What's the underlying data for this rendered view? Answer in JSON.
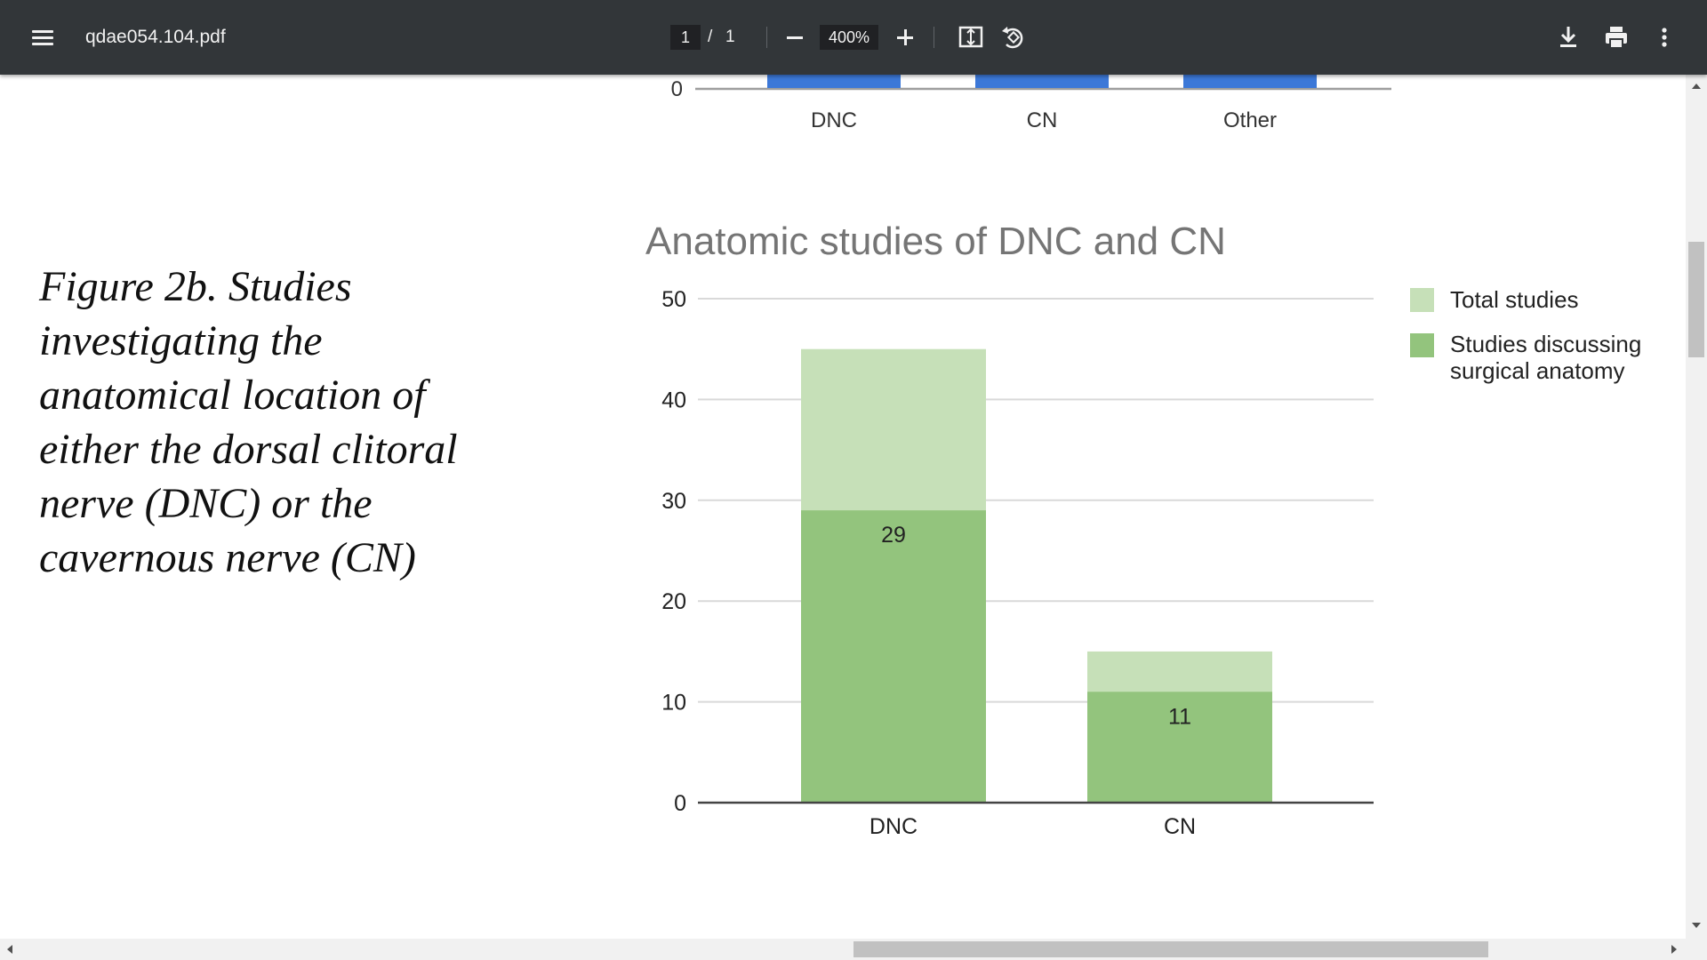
{
  "toolbar": {
    "file_name": "qdae054.104.pdf",
    "page_current": "1",
    "page_separator": "/",
    "page_total": "1",
    "zoom": "400%"
  },
  "figure_caption": [
    "Figure 2b. Studies",
    "investigating the",
    "anatomical location of",
    "either the  dorsal clitoral",
    "nerve (DNC) or the",
    "cavernous nerve (CN)"
  ],
  "colors": {
    "toolbar_bg": "#323639",
    "total_studies": "#c6e0b8",
    "surgical_anatomy": "#93c47d",
    "prev_chart_bar": "#3c78d8"
  },
  "icons": [
    "menu-icon",
    "minus-icon",
    "plus-icon",
    "fit-to-page-icon",
    "rotate-icon",
    "download-icon",
    "print-icon",
    "more-vert-icon"
  ],
  "scroll": {
    "vertical_position": 0.18,
    "vertical_visible": 0.14,
    "horizontal_position": 0.5,
    "horizontal_visible": 0.38
  },
  "chart_data": [
    {
      "type": "bar",
      "partially_visible": true,
      "categories": [
        "DNC",
        "CN",
        "Other"
      ],
      "visible_tick_labels": [
        "0"
      ]
    },
    {
      "type": "bar",
      "stacked": true,
      "title": "Anatomic studies of DNC and CN",
      "categories": [
        "DNC",
        "CN"
      ],
      "series": [
        {
          "name": "Total studies",
          "values": [
            45,
            15
          ]
        },
        {
          "name": "Studies discussing surgical anatomy",
          "values": [
            29,
            11
          ]
        }
      ],
      "data_labels": [
        "29",
        "11"
      ],
      "ylim": [
        0,
        50
      ],
      "yticks": [
        "0",
        "10",
        "20",
        "30",
        "40",
        "50"
      ],
      "grid": true,
      "legend_position": "right"
    }
  ]
}
